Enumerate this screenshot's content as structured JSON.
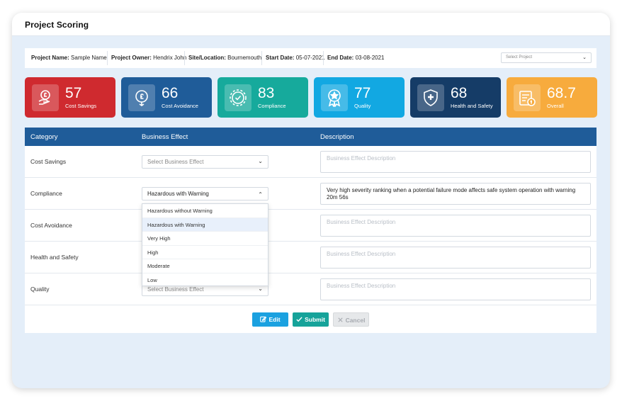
{
  "window_title": "Project Scoring",
  "info": {
    "project_name_label": "Project Name:",
    "project_name": "Sample Name",
    "owner_label": "Project Owner:",
    "owner": "Hendrix John",
    "site_label": "Site/Location:",
    "site": "Bournemouth",
    "start_label": "Start Date:",
    "start": "05-07-2021",
    "end_label": "End Date:",
    "end": "03-08-2021",
    "select_project_placeholder": "Select Project"
  },
  "cards": [
    {
      "value": "57",
      "label": "Cost Savings",
      "color": "#cf2a2f",
      "icon": "money-hand-icon"
    },
    {
      "value": "66",
      "label": "Cost Avoidance",
      "color": "#1f5c99",
      "icon": "pound-shield-icon"
    },
    {
      "value": "83",
      "label": "Compliance",
      "color": "#16aa9c",
      "icon": "gear-check-icon"
    },
    {
      "value": "77",
      "label": "Quality",
      "color": "#12a8e2",
      "icon": "star-badge-icon"
    },
    {
      "value": "68",
      "label": "Health and Safety",
      "color": "#153c67",
      "icon": "shield-plus-icon"
    },
    {
      "value": "68.7",
      "label": "Overall",
      "color": "#f7ab3d",
      "icon": "report-icon"
    }
  ],
  "table": {
    "headers": [
      "Category",
      "Business Effect",
      "Description"
    ],
    "rows": [
      {
        "category": "Cost Savings",
        "effect": "Select Business Effect",
        "description": "Business Effect Description"
      },
      {
        "category": "Compliance",
        "effect": "Hazardous with Warning",
        "description": "Very high severity ranking when a potential failure mode affects safe system operation with warning 20m 56s"
      },
      {
        "category": "Cost Avoidance",
        "effect": "",
        "description": "Business Effect Description"
      },
      {
        "category": "Health and Safety",
        "effect": "",
        "description": "Business Effect Description"
      },
      {
        "category": "Quality",
        "effect": "Select Business Effect",
        "description": "Business Effect Description"
      }
    ]
  },
  "dropdown_options": [
    "Hazardous without Warning",
    "Hazardous with Warning",
    "Very High",
    "High",
    "Moderate",
    "Low"
  ],
  "buttons": {
    "edit": "Edit",
    "submit": "Submit",
    "cancel": "Cancel"
  }
}
